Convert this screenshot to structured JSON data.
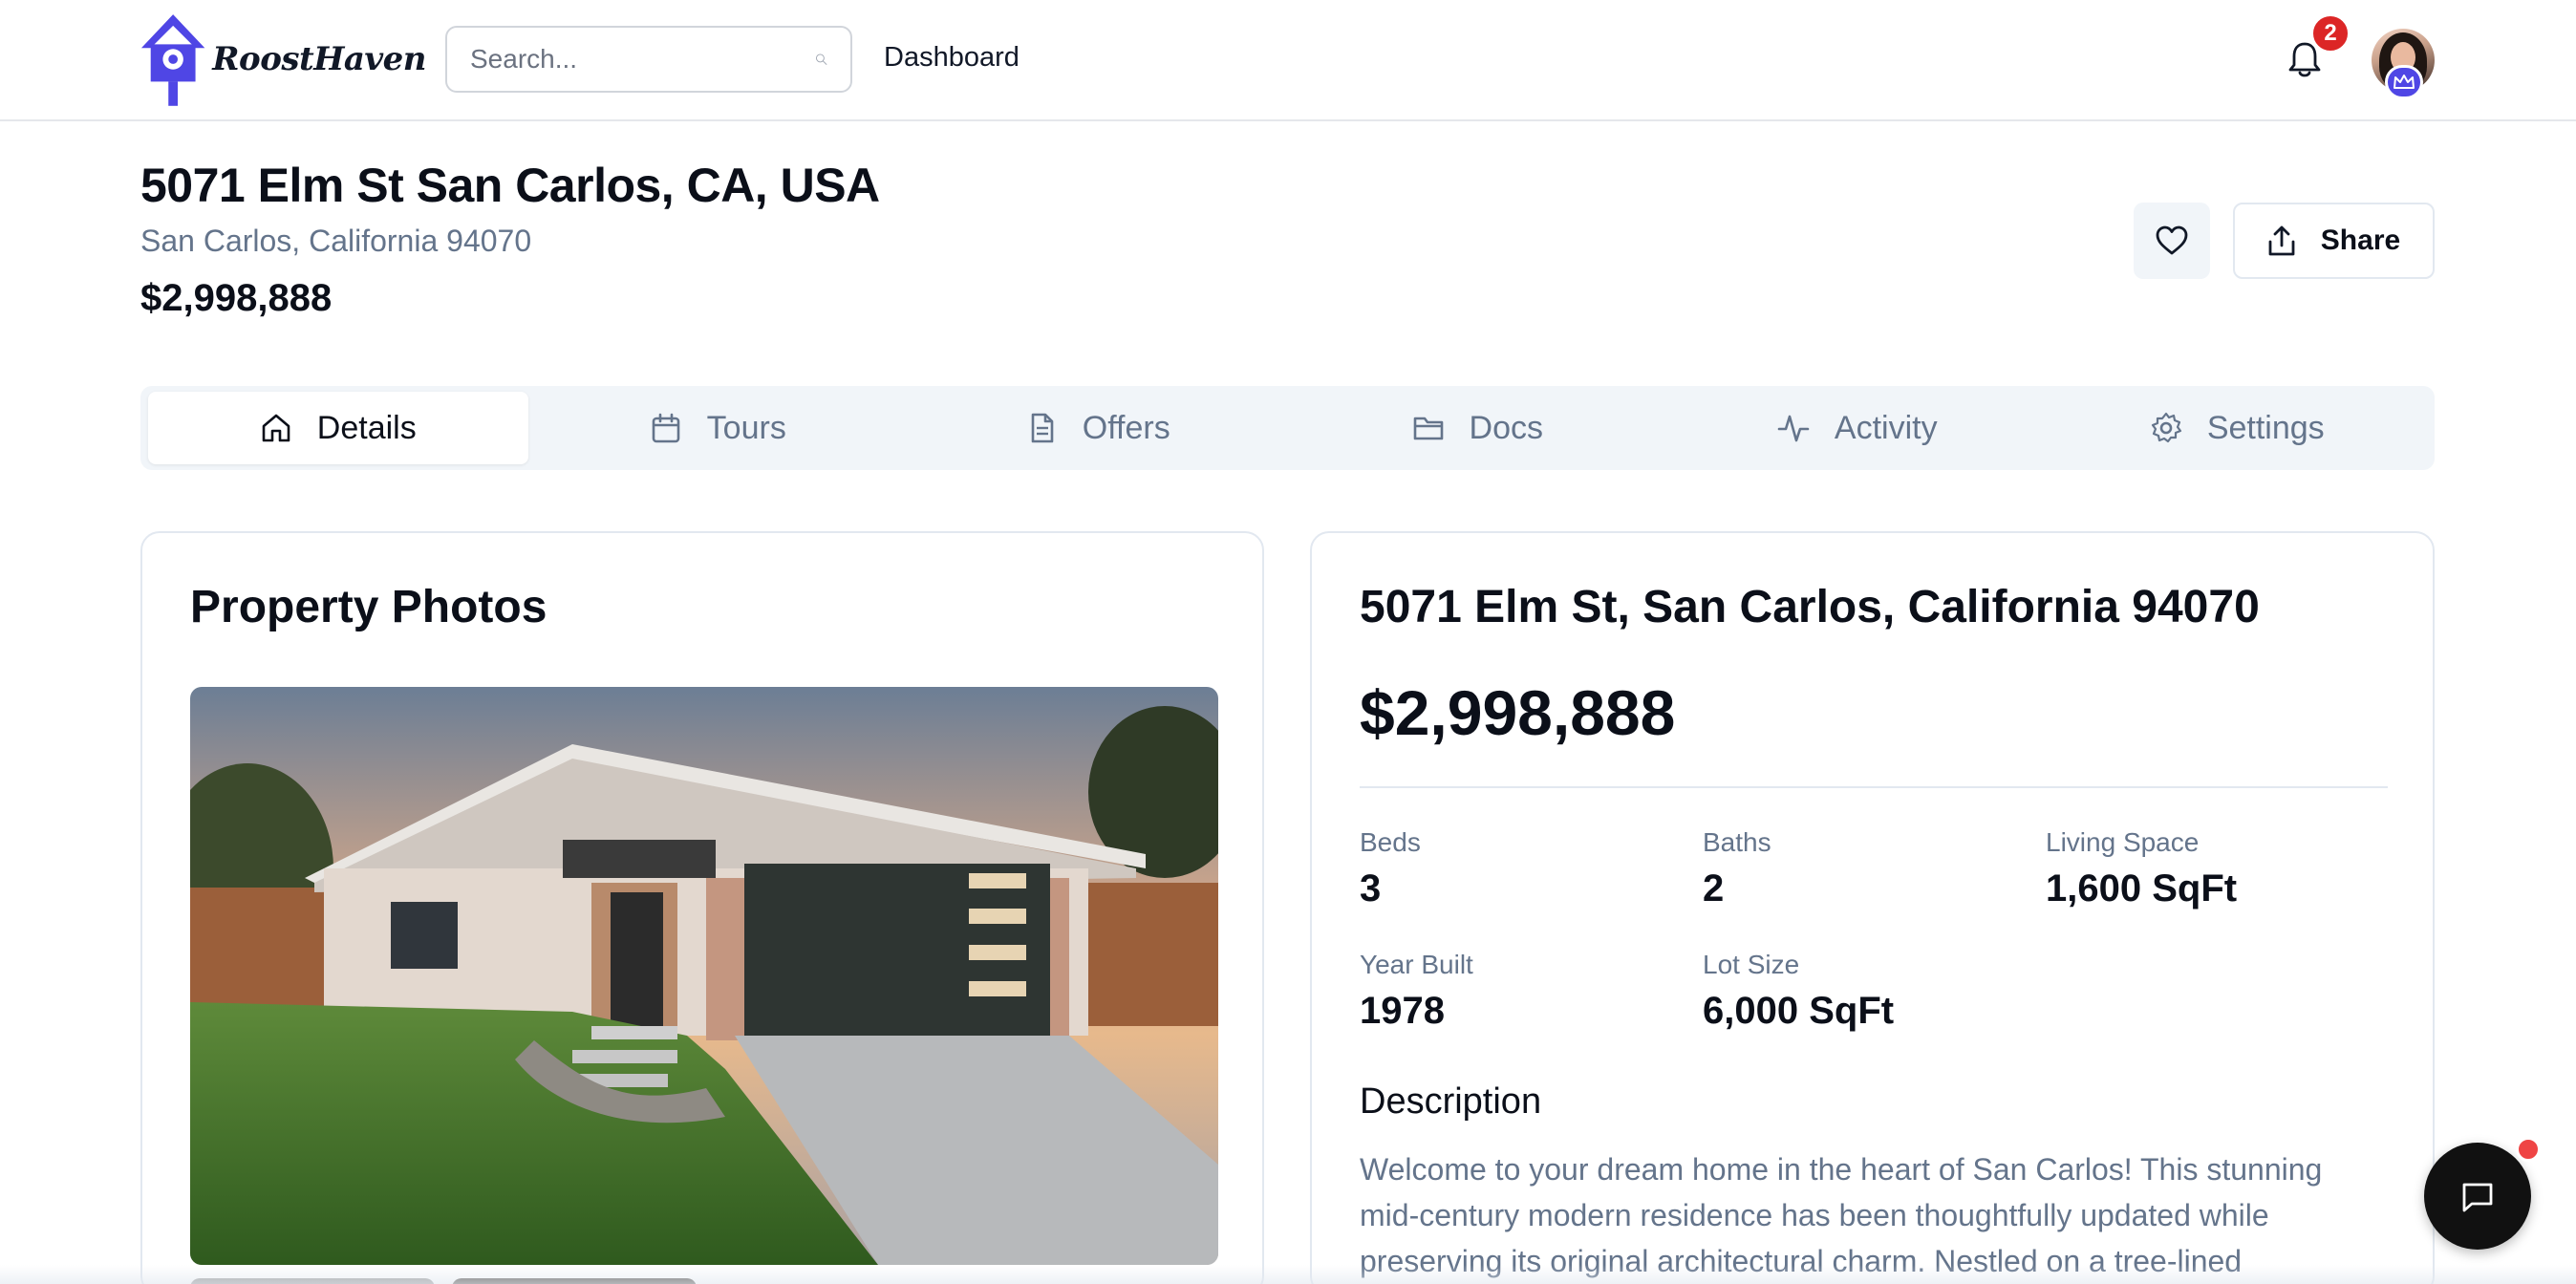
{
  "header": {
    "brand": "RoostHaven",
    "search_placeholder": "Search...",
    "nav_dashboard": "Dashboard",
    "notification_count": "2",
    "accent_color": "#4f46e5"
  },
  "property": {
    "title": "5071 Elm St San Carlos, CA, USA",
    "subtitle": "San Carlos, California 94070",
    "price": "$2,998,888",
    "share_label": "Share"
  },
  "tabs": [
    {
      "label": "Details",
      "icon": "home-icon",
      "active": true
    },
    {
      "label": "Tours",
      "icon": "calendar-icon",
      "active": false
    },
    {
      "label": "Offers",
      "icon": "document-icon",
      "active": false
    },
    {
      "label": "Docs",
      "icon": "folder-icon",
      "active": false
    },
    {
      "label": "Activity",
      "icon": "activity-icon",
      "active": false
    },
    {
      "label": "Settings",
      "icon": "gear-icon",
      "active": false
    }
  ],
  "photos": {
    "title": "Property Photos"
  },
  "details": {
    "address": "5071 Elm St, San Carlos, California 94070",
    "price": "$2,998,888",
    "stats": [
      {
        "label": "Beds",
        "value": "3"
      },
      {
        "label": "Baths",
        "value": "2"
      },
      {
        "label": "Living Space",
        "value": "1,600 SqFt"
      },
      {
        "label": "Year Built",
        "value": "1978"
      },
      {
        "label": "Lot Size",
        "value": "6,000 SqFt"
      }
    ],
    "description_title": "Description",
    "description": "Welcome to your dream home in the heart of San Carlos! This stunning mid-century modern residence has been thoughtfully updated while preserving its original architectural charm. Nestled on a tree-lined"
  }
}
